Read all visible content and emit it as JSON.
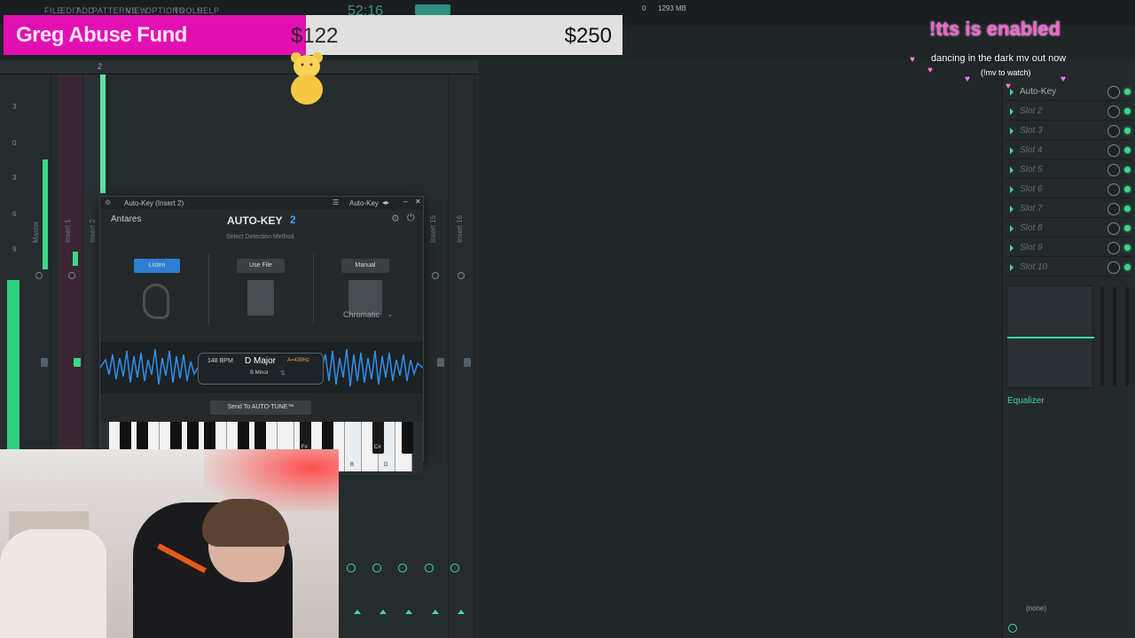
{
  "menu": {
    "items": [
      "FILE",
      "EDIT",
      "ADD",
      "PATTERNS",
      "VIEW",
      "OPTIONS",
      "TOOLS",
      "HELP"
    ],
    "time": "52:16",
    "memory": "1293 MB",
    "cpu": "0"
  },
  "donation": {
    "title": "Greg Abuse Fund",
    "current": "$122",
    "goal": "$250",
    "progress": 0.488
  },
  "overlay": {
    "tts": "!tts is enabled",
    "mv_text": "dancing in the dark mv out now",
    "mv_sub": "(!mv to watch)"
  },
  "mixer": {
    "strips": [
      {
        "label": "Master"
      },
      {
        "label": "Insert 1"
      },
      {
        "label": "Insert 2"
      },
      {
        "label": "Insert 15"
      },
      {
        "label": "Insert 16"
      }
    ],
    "ruler": [
      "3",
      "0",
      "3",
      "6",
      "9"
    ]
  },
  "plugin": {
    "window_title": "Auto-Key (Insert 2)",
    "preset": "Auto-Key",
    "brand": "Antares",
    "product": "AUTO-KEY",
    "version": "2",
    "subtitle": "Select Detection Method",
    "methods": [
      {
        "label": "Listen",
        "active": true
      },
      {
        "label": "Use File",
        "active": false
      },
      {
        "label": "Manual",
        "active": false
      }
    ],
    "scale_select": "Chromatic",
    "bpm": "148 BPM",
    "key": "D Major",
    "relative_key": "B Minor",
    "tuning": "A=439Hz",
    "send_button": "Send To AUTO-TUNE™",
    "key_labels": [
      "F#",
      "C#",
      "B",
      "D"
    ]
  },
  "rightpanel": {
    "slots": [
      {
        "label": "Auto-Key",
        "active": true
      },
      {
        "label": "Slot 2",
        "active": false
      },
      {
        "label": "Slot 3",
        "active": false
      },
      {
        "label": "Slot 4",
        "active": false
      },
      {
        "label": "Slot 5",
        "active": false
      },
      {
        "label": "Slot 6",
        "active": false
      },
      {
        "label": "Slot 7",
        "active": false
      },
      {
        "label": "Slot 8",
        "active": false
      },
      {
        "label": "Slot 9",
        "active": false
      },
      {
        "label": "Slot 10",
        "active": false
      }
    ],
    "equalizer": "Equalizer",
    "output": "(none)"
  },
  "colors": {
    "accent": "#3ad7a8",
    "meter": "#3cd98a",
    "donation_fill": "#e20fb3",
    "tts": "#ff5fd2",
    "listen_active": "#2f7fd4"
  }
}
